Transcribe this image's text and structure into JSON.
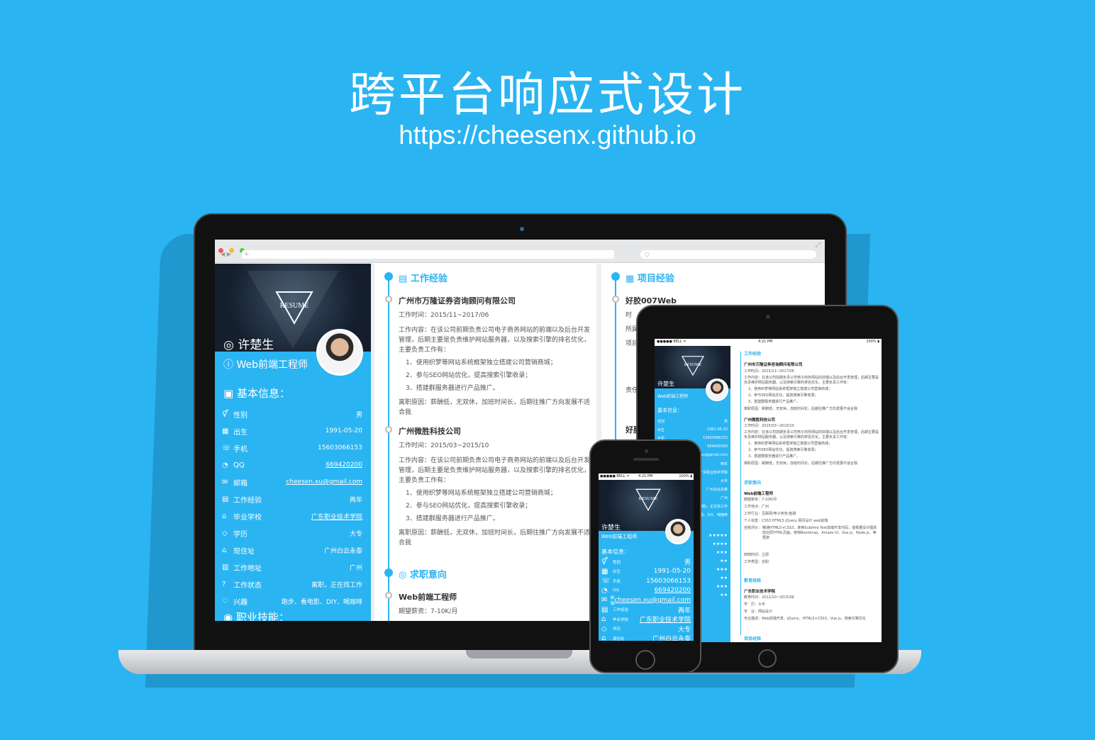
{
  "hero": {
    "title": "跨平台响应式设计",
    "url": "https://cheesenx.github.io"
  },
  "colors": {
    "background": "#2ab4f2",
    "accent": "#2ab4f2",
    "dark": "#141e2c"
  },
  "browser": {
    "address_placeholder": "+",
    "search_placeholder": "search-icon"
  },
  "profile": {
    "logo_text": "RESUME",
    "name": "许楚生",
    "title": "Web前端工程师",
    "basic_info_heading": "基本信息：",
    "skills_heading": "职业技能：",
    "fields": [
      {
        "icon": "gender-icon",
        "label": "性别",
        "value": "男"
      },
      {
        "icon": "calendar-icon",
        "label": "出生",
        "value": "1991-05-20"
      },
      {
        "icon": "phone-icon",
        "label": "手机",
        "value": "15603066153"
      },
      {
        "icon": "qq-icon",
        "label": "QQ",
        "value": "669420200",
        "link": true
      },
      {
        "icon": "mail-icon",
        "label": "邮箱",
        "value": "cheesen.xu@gmail.com",
        "link": true
      },
      {
        "icon": "briefcase-icon",
        "label": "工作经验",
        "value": "两年"
      },
      {
        "icon": "school-icon",
        "label": "毕业学校",
        "value": "广东职业技术学院",
        "link": true
      },
      {
        "icon": "degree-icon",
        "label": "学历",
        "value": "大专"
      },
      {
        "icon": "home-icon",
        "label": "现住址",
        "value": "广州白云永泰"
      },
      {
        "icon": "building-icon",
        "label": "工作地址",
        "value": "广州"
      },
      {
        "icon": "question-icon",
        "label": "工作状态",
        "value": "离职，正在找工作"
      },
      {
        "icon": "heart-icon",
        "label": "兴趣",
        "value": "跑步、看电影、DIY、喝咖啡"
      }
    ]
  },
  "work": {
    "heading": "工作经验",
    "jobs": [
      {
        "company": "广州市万隆证券咨询顾问有限公司",
        "time": "工作时间：2015/11~2017/06",
        "content": "工作内容：在该公司前期负责公司电子商务网站的前端以及后台开发管理，后期主要是负责维护网站服务器，以及搜索引擎的排名优化，主要负责工作有：",
        "items": [
          "1、使用织梦等网站系统框架独立搭建公司营销商城；",
          "2、参与SEO网站优化，提高搜索引擎收录；",
          "3、搭建群服务器进行产品推广。"
        ],
        "leave": "离职原因：薪酬低，无双休，加班时间长，后期往推广方向发展不适合我"
      },
      {
        "company": "广州微胜科技公司",
        "time": "工作时间：2015/03~2015/10",
        "content": "工作内容：在该公司前期负责公司电子商务网站的前端以及后台开发管理，后期主要是负责维护网站服务器，以及搜索引擎的排名优化，主要负责工作有：",
        "items": [
          "1、使用织梦等网站系统框架独立搭建公司营销商城；",
          "2、参与SEO网站优化，提高搜索引擎收录；",
          "3、搭建群服务器进行产品推广。"
        ],
        "leave": "离职原因：薪酬低，无双休，加班时间长，后期往推广方向发展不适合我"
      }
    ]
  },
  "intent": {
    "heading": "求职意向",
    "position": "Web前端工程师",
    "salary": "期望薪资：7-10K/月"
  },
  "projects": {
    "heading": "项目经验",
    "first": "好胶007Web",
    "fragments": [
      "时",
      "所属",
      "项目",
      "责任",
      "好胶"
    ]
  },
  "tablet": {
    "status_left": "●●●●● BELL ᯤ",
    "status_time": "4:21 PM",
    "status_right": "100% ▮",
    "extra_sections": [
      "求职意向",
      "教育经验",
      "项目经验"
    ],
    "intent_lines": [
      "期望薪资：7-10K/月",
      "工作地点：广州",
      "工作行业：互联网/电子商务/金融",
      "个人标签：CSS3 HTML5 jQuery 网页设计 web前端"
    ],
    "edu": {
      "school": "广东职业技术学院",
      "time": "教育时间：2012/10~2015/06",
      "degree": "学　历：大专",
      "major": "专　业：网站设计",
      "desc": "专业描述：Web前端开发、jQuery、HTML5+CSS3、Vue.js、搜索引擎优化"
    },
    "stars": [
      "★★★★★",
      "★★★★",
      "★★★",
      "★★",
      "★★★",
      "★★",
      "★★★",
      "★★"
    ],
    "self_eval_title": "自我评价：",
    "self_eval": "精通HTML5+CSS3，使用Sublime Text前端开发代码，能根据设计图高效还原HTML页面，使用Bootstrap、Amaze UI、Vue.js、Node.js、等框架",
    "arrive": "到岗时间：立即",
    "job_type": "工作类型：全职"
  },
  "phone": {
    "status_left": "●●●●● BELL ᯤ",
    "status_time": "4:21 PM",
    "status_right": "100% ▮"
  }
}
